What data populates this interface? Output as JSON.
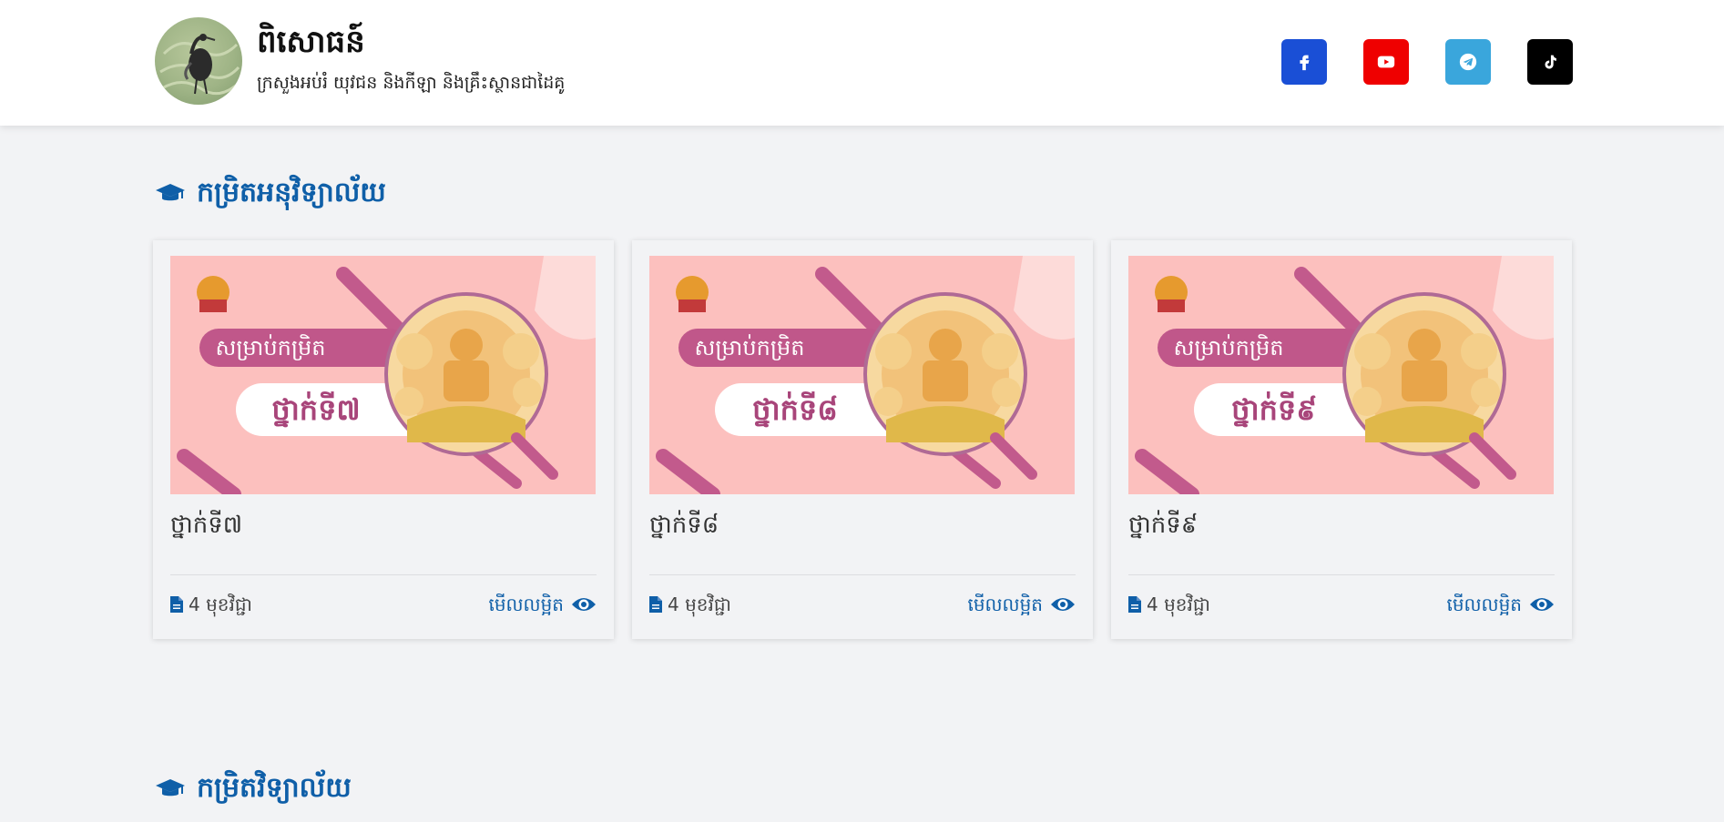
{
  "header": {
    "title": "ពិសោធន៍",
    "subtitle": "ក្រសួងអប់រំ យុវជន និងកីឡា និងគ្រឹះស្ថានជាដៃគូ",
    "logo_icon": "crane-bird-logo"
  },
  "social": [
    {
      "name": "facebook",
      "icon": "facebook-icon",
      "color": "#1a4fd6"
    },
    {
      "name": "youtube",
      "icon": "youtube-icon",
      "color": "#ef0000"
    },
    {
      "name": "telegram",
      "icon": "telegram-icon",
      "color": "#3aa6dc"
    },
    {
      "name": "tiktok",
      "icon": "tiktok-icon",
      "color": "#000000"
    }
  ],
  "sections": [
    {
      "title": "កម្រិតអនុវិទ្យាល័យ",
      "icon": "graduation-cap-icon",
      "cards": [
        {
          "banner_top": "សម្រាប់កម្រិត",
          "banner_grade": "ថ្នាក់ទី៧",
          "title": "ថ្នាក់ទី៧",
          "count": "4 មុខវិជ្ជា",
          "view": "មើលលម្អិត"
        },
        {
          "banner_top": "សម្រាប់កម្រិត",
          "banner_grade": "ថ្នាក់ទី៨",
          "title": "ថ្នាក់ទី៨",
          "count": "4 មុខវិជ្ជា",
          "view": "មើលលម្អិត"
        },
        {
          "banner_top": "សម្រាប់កម្រិត",
          "banner_grade": "ថ្នាក់ទី៩",
          "title": "ថ្នាក់ទី៩",
          "count": "4 មុខវិជ្ជា",
          "view": "មើលលម្អិត"
        }
      ]
    },
    {
      "title": "កម្រិតវិទ្យាល័យ",
      "icon": "graduation-cap-icon",
      "cards": []
    }
  ],
  "colors": {
    "accent": "#0f5fa8",
    "banner_bg": "#fcc0be",
    "banner_pill": "#c0578a",
    "page_bg": "#f2f3f5"
  }
}
